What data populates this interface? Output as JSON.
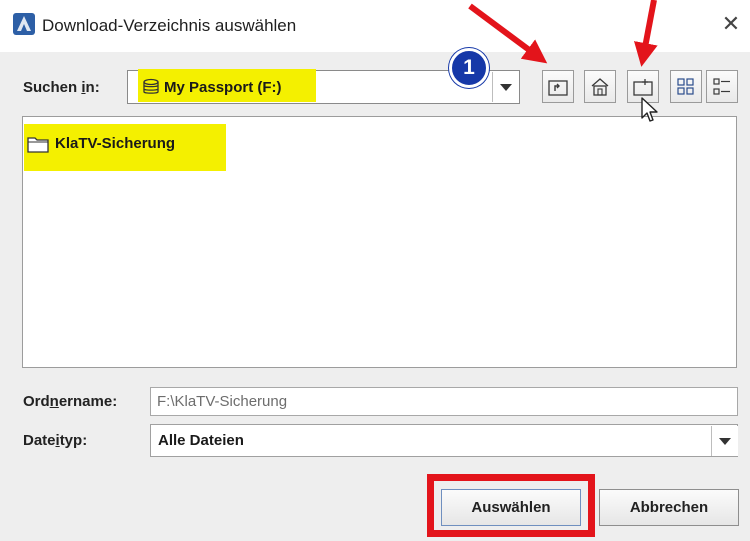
{
  "window": {
    "title": "Download-Verzeichnis auswählen",
    "close_label": "✕"
  },
  "lookin": {
    "label_pre": "Suchen ",
    "label_mnemonic": "i",
    "label_post": "n:",
    "value": "My Passport (F:)"
  },
  "toolbar": {
    "buttons": [
      "up-one-level",
      "home",
      "new-folder",
      "list-view",
      "details-view"
    ]
  },
  "annotation": {
    "badge_number": "1",
    "highlight_color": "#f4f000",
    "arrow_color": "#e3141b"
  },
  "files": {
    "items": [
      {
        "name": "KlaTV-Sicherung",
        "type": "folder"
      }
    ]
  },
  "filename": {
    "label_pre": "Ord",
    "label_mnemonic": "n",
    "label_post": "ername:",
    "value": "F:\\KlaTV-Sicherung"
  },
  "filetype": {
    "label_pre": "Date",
    "label_mnemonic": "i",
    "label_post": "typ:",
    "value": "Alle Dateien"
  },
  "buttons": {
    "approve": "Auswählen",
    "cancel": "Abbrechen"
  }
}
